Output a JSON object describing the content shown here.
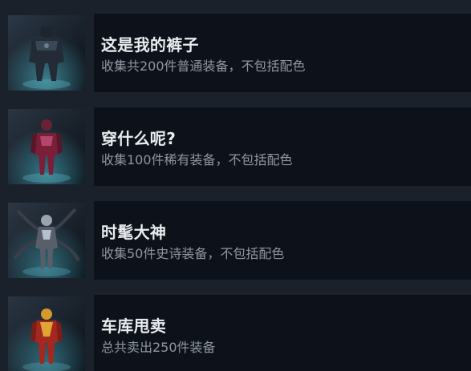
{
  "achievements": [
    {
      "title": "这是我的裤子",
      "description": "收集共200件普通装备，不包括配色",
      "icon": "dark-armored-hero-icon"
    },
    {
      "title": "穿什么呢?",
      "description": "收集100件稀有装备，不包括配色",
      "icon": "red-suited-hero-icon"
    },
    {
      "title": "时髦大神",
      "description": "收集50件史诗装备，不包括配色",
      "icon": "tentacled-villain-icon"
    },
    {
      "title": "车库甩卖",
      "description": "总共卖出250件装备",
      "icon": "gold-red-speedster-icon"
    }
  ]
}
